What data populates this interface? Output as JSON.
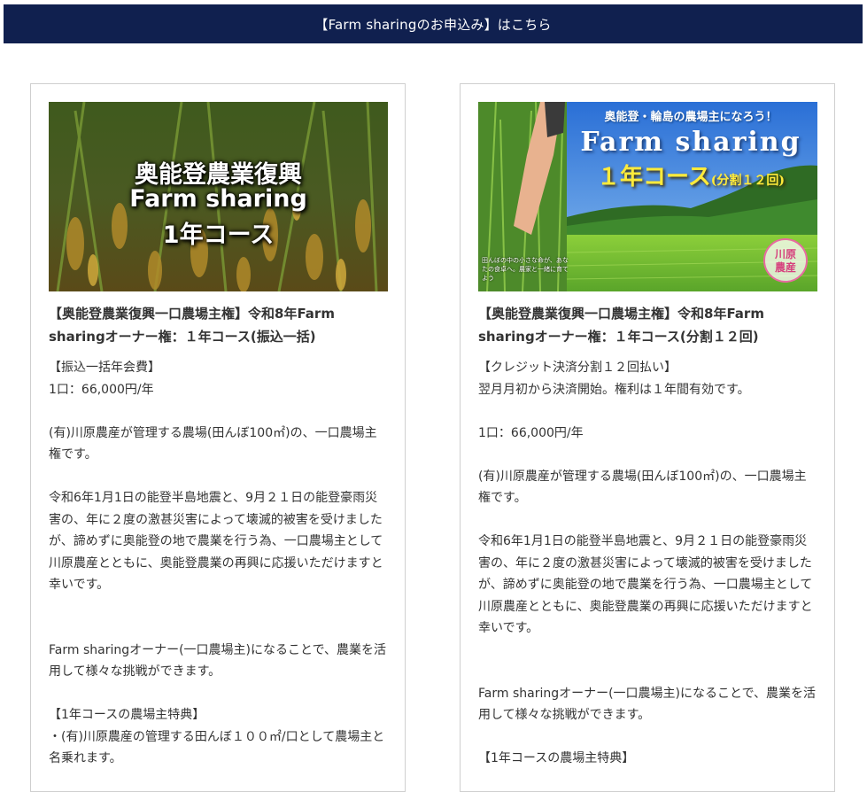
{
  "banner": {
    "label": "【Farm sharingのお申込み】はこちら"
  },
  "cards": [
    {
      "image": {
        "line1": "奥能登農業復興",
        "line2": "Farm sharing",
        "line3": "1年コース"
      },
      "title": "【奥能登農業復興一口農場主権】令和8年Farm sharingオーナー権：１年コース(振込一括)",
      "body": {
        "fee_label": "【振込一括年会費】",
        "price": "1口：66,000円/年",
        "desc1": "(有)川原農産が管理する農場(田んぼ100㎡)の、一口農場主権です。",
        "desc2": "令和6年1月1日の能登半島地震と、9月２１日の能登豪雨災害の、年に２度の激甚災害によって壊滅的被害を受けましたが、諦めずに奥能登の地で農業を行う為、一口農場主として川原農産とともに、奥能登農業の再興に応援いただけますと幸いです。",
        "desc3": "Farm sharingオーナー(一口農場主)になることで、農業を活用して様々な挑戦ができます。",
        "benefit_label": "【1年コースの農場主特典】",
        "benefit1": "・(有)川原農産の管理する田んぼ１００㎡/口として農場主と名乗れます。"
      }
    },
    {
      "image": {
        "tagline": "奥能登・輪島の農場主になろう！",
        "farm": "Farm sharing",
        "course_big": "１年コース",
        "course_small": "(分割１２回)",
        "stamp_line1": "川原",
        "stamp_line2": "農産",
        "small_text": "田んぼの中の小さな命が、あなたの食卓へ。農家と一緒に育てよう"
      },
      "title": "【奥能登農業復興一口農場主権】令和8年Farm sharingオーナー権：１年コース(分割１２回)",
      "body": {
        "fee_label": "【クレジット決済分割１２回払い】",
        "fee_note": "翌月月初から決済開始。権利は１年間有効です。",
        "price": "1口：66,000円/年",
        "desc1": "(有)川原農産が管理する農場(田んぼ100㎡)の、一口農場主権です。",
        "desc2": "令和6年1月1日の能登半島地震と、9月２１日の能登豪雨災害の、年に２度の激甚災害によって壊滅的被害を受けましたが、諦めずに奥能登の地で農業を行う為、一口農場主として川原農産とともに、奥能登農業の再興に応援いただけますと幸いです。",
        "desc3": "Farm sharingオーナー(一口農場主)になることで、農業を活用して様々な挑戦ができます。",
        "benefit_label": "【1年コースの農場主特典】"
      }
    }
  ]
}
